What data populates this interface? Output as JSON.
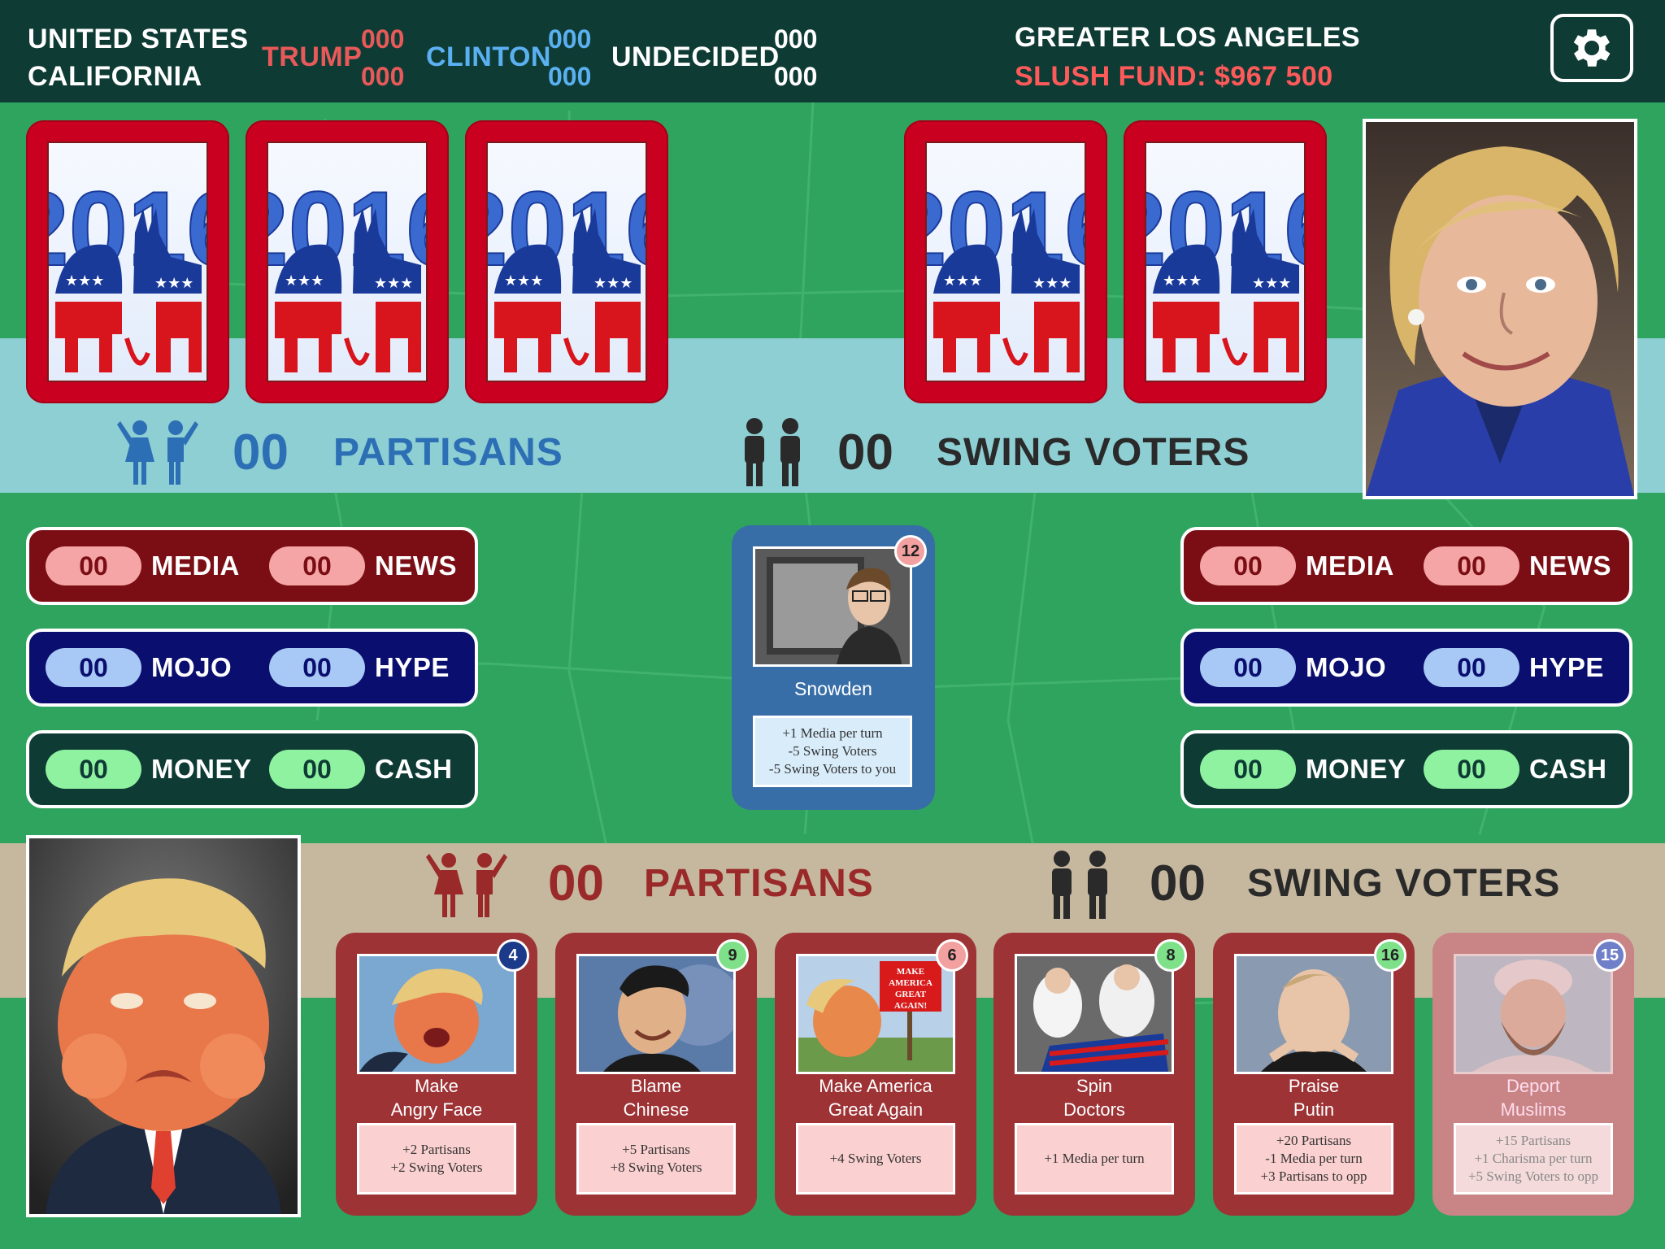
{
  "header": {
    "location_line1": "UNITED STATES",
    "location_line2": "CALIFORNIA",
    "trump_label": "TRUMP",
    "trump_top": "000",
    "trump_bottom": "000",
    "clinton_label": "CLINTON",
    "clinton_top": "000",
    "clinton_bottom": "000",
    "undecided_label": "UNDECIDED",
    "undecided_top": "000",
    "undecided_bottom": "000",
    "region": "GREATER LOS ANGELES",
    "slush_fund": "SLUSH FUND: $967 500",
    "settings_icon": "gear-icon"
  },
  "colors": {
    "header_bg": "#0f3b35",
    "trump_red": "#e85a5a",
    "clinton_blue": "#5ab0f0",
    "slush_red": "#ff5a5a",
    "map_green": "#2fa45f",
    "clinton_band": "#8ecfd4",
    "trump_band": "#c6b89e",
    "card_red": "#c9001f"
  },
  "opponent": {
    "name": "Clinton",
    "hand_count_label": "2016",
    "partisans": {
      "value": "00",
      "label": "PARTISANS"
    },
    "swing": {
      "value": "00",
      "label": "SWING VOTERS"
    },
    "stats": {
      "media": {
        "value": "00",
        "label": "MEDIA"
      },
      "news": {
        "value": "00",
        "label": "NEWS"
      },
      "mojo": {
        "value": "00",
        "label": "MOJO"
      },
      "hype": {
        "value": "00",
        "label": "HYPE"
      },
      "money": {
        "value": "00",
        "label": "MONEY"
      },
      "cash": {
        "value": "00",
        "label": "CASH"
      }
    }
  },
  "player": {
    "name": "Trump",
    "partisans": {
      "value": "00",
      "label": "PARTISANS"
    },
    "swing": {
      "value": "00",
      "label": "SWING VOTERS"
    },
    "stats": {
      "media": {
        "value": "00",
        "label": "MEDIA"
      },
      "news": {
        "value": "00",
        "label": "NEWS"
      },
      "mojo": {
        "value": "00",
        "label": "MOJO"
      },
      "hype": {
        "value": "00",
        "label": "HYPE"
      },
      "money": {
        "value": "00",
        "label": "MONEY"
      },
      "cash": {
        "value": "00",
        "label": "CASH"
      }
    }
  },
  "played_card": {
    "cost": "12",
    "title": "Snowden",
    "effects": [
      "+1 Media per turn",
      "-5 Swing Voters",
      "-5 Swing Voters to you"
    ]
  },
  "hand": [
    {
      "cost": "4",
      "cost_color": "#1b3a8a",
      "title1": "Make",
      "title2": "Angry Face",
      "effects": [
        "+2 Partisans",
        "+2 Swing Voters"
      ],
      "playable": true
    },
    {
      "cost": "9",
      "cost_color": "#7fe08a",
      "title1": "Blame",
      "title2": "Chinese",
      "effects": [
        "+5 Partisans",
        "+8 Swing Voters"
      ],
      "playable": true
    },
    {
      "cost": "6",
      "cost_color": "#f2a0a0",
      "title1": "Make America",
      "title2": "Great Again",
      "effects": [
        "+4 Swing Voters"
      ],
      "playable": true,
      "sign_text": "MAKE AMERICA GREAT AGAIN!"
    },
    {
      "cost": "8",
      "cost_color": "#7fe08a",
      "title1": "Spin",
      "title2": "Doctors",
      "effects": [
        "+1 Media per turn"
      ],
      "playable": true
    },
    {
      "cost": "16",
      "cost_color": "#7fe08a",
      "title1": "Praise",
      "title2": "Putin",
      "effects": [
        "+20 Partisans",
        "-1 Media per turn",
        "+3 Partisans to opp"
      ],
      "playable": true
    },
    {
      "cost": "15",
      "cost_color": "#6f7fc8",
      "title1": "Deport",
      "title2": "Muslims",
      "effects": [
        "+15 Partisans",
        "+1 Charisma per turn",
        "+5 Swing Voters to opp"
      ],
      "playable": false
    }
  ]
}
